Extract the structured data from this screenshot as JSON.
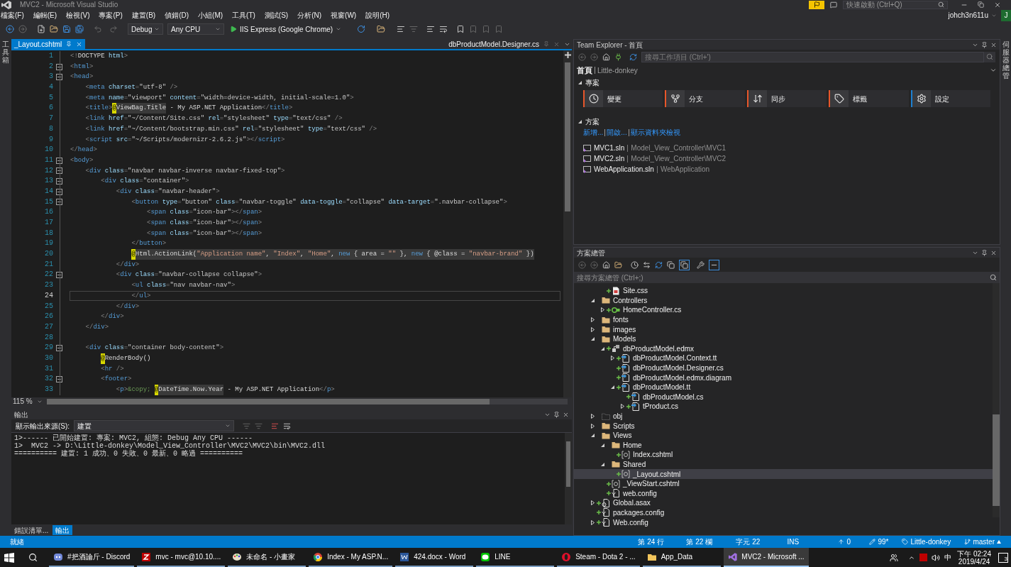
{
  "title_bar": {
    "title": "MVC2 - Microsoft Visual Studio",
    "quick_launch": {
      "placeholder": "快速啟動 (Ctrl+Q)"
    }
  },
  "menu": [
    "檔案(F)",
    "編輯(E)",
    "檢視(V)",
    "專案(P)",
    "建置(B)",
    "偵錯(D)",
    "小組(M)",
    "工具(T)",
    "測試(S)",
    "分析(N)",
    "視窗(W)",
    "說明(H)"
  ],
  "account": {
    "user": "johch3n611u",
    "avatar": "J"
  },
  "toolbar": {
    "configuration": "Debug",
    "platform": "Any CPU",
    "run_target": "IIS Express (Google Chrome)"
  },
  "left_strip": {
    "label": "工具箱"
  },
  "right_strip": {
    "label": "伺服器總管"
  },
  "editor": {
    "tabs": [
      {
        "label": "_Layout.cshtml",
        "selected": true
      },
      {
        "label": "dbProductModel.Designer.cs",
        "selected": false
      }
    ],
    "zoom": "115 %",
    "lines": [
      {
        "n": "1",
        "fold": false,
        "current": false,
        "code": "<!DOCTYPE html>"
      },
      {
        "n": "2",
        "fold": true,
        "current": false,
        "code": "<html>"
      },
      {
        "n": "3",
        "fold": true,
        "current": false,
        "code": "<head>"
      },
      {
        "n": "4",
        "fold": false,
        "current": false,
        "code": "    <meta charset=\"utf-8\" />"
      },
      {
        "n": "5",
        "fold": false,
        "current": false,
        "code": "    <meta name=\"viewport\" content=\"width=device-width, initial-scale=1.0\">"
      },
      {
        "n": "6",
        "fold": false,
        "current": false,
        "code": "    <title>@ViewBag.Title - My ASP.NET Application</title>"
      },
      {
        "n": "7",
        "fold": false,
        "current": false,
        "code": "    <link href=\"~/Content/Site.css\" rel=\"stylesheet\" type=\"text/css\" />"
      },
      {
        "n": "8",
        "fold": false,
        "current": false,
        "code": "    <link href=\"~/Content/bootstrap.min.css\" rel=\"stylesheet\" type=\"text/css\" />"
      },
      {
        "n": "9",
        "fold": false,
        "current": false,
        "code": "    <script src=\"~/Scripts/modernizr-2.6.2.js\"></script>"
      },
      {
        "n": "10",
        "fold": false,
        "current": false,
        "code": "</head>"
      },
      {
        "n": "11",
        "fold": true,
        "current": false,
        "code": "<body>"
      },
      {
        "n": "12",
        "fold": true,
        "current": false,
        "code": "    <div class=\"navbar navbar-inverse navbar-fixed-top\">"
      },
      {
        "n": "13",
        "fold": true,
        "current": false,
        "code": "        <div class=\"container\">"
      },
      {
        "n": "14",
        "fold": true,
        "current": false,
        "code": "            <div class=\"navbar-header\">"
      },
      {
        "n": "15",
        "fold": true,
        "current": false,
        "code": "                <button type=\"button\" class=\"navbar-toggle\" data-toggle=\"collapse\" data-target=\".navbar-collapse\">"
      },
      {
        "n": "16",
        "fold": false,
        "current": false,
        "code": "                    <span class=\"icon-bar\"></span>"
      },
      {
        "n": "17",
        "fold": false,
        "current": false,
        "code": "                    <span class=\"icon-bar\"></span>"
      },
      {
        "n": "18",
        "fold": false,
        "current": false,
        "code": "                    <span class=\"icon-bar\"></span>"
      },
      {
        "n": "19",
        "fold": false,
        "current": false,
        "code": "                </button>"
      },
      {
        "n": "20",
        "fold": false,
        "current": false,
        "code": "                @Html.ActionLink(\"Application name\", \"Index\", \"Home\", new { area = \"\" }, new { @class = \"navbar-brand\" })"
      },
      {
        "n": "21",
        "fold": false,
        "current": false,
        "code": "            </div>"
      },
      {
        "n": "22",
        "fold": true,
        "current": false,
        "code": "            <div class=\"navbar-collapse collapse\">"
      },
      {
        "n": "23",
        "fold": false,
        "current": false,
        "code": "                <ul class=\"nav navbar-nav\">"
      },
      {
        "n": "24",
        "fold": false,
        "current": true,
        "code": "                </ul>"
      },
      {
        "n": "25",
        "fold": false,
        "current": false,
        "code": "            </div>"
      },
      {
        "n": "26",
        "fold": false,
        "current": false,
        "code": "        </div>"
      },
      {
        "n": "27",
        "fold": false,
        "current": false,
        "code": "    </div>"
      },
      {
        "n": "28",
        "fold": false,
        "current": false
      },
      {
        "n": "29",
        "fold": true,
        "current": false,
        "code": "    <div class=\"container body-content\">"
      },
      {
        "n": "30",
        "fold": false,
        "current": false,
        "code": "        @RenderBody()"
      },
      {
        "n": "31",
        "fold": false,
        "current": false,
        "code": "        <hr />"
      },
      {
        "n": "32",
        "fold": true,
        "current": false,
        "code": "        <footer>"
      },
      {
        "n": "33",
        "fold": false,
        "current": false,
        "code": "            <p>&copy; @DateTime.Now.Year - My ASP.NET Application</p>"
      }
    ]
  },
  "output": {
    "title": "輸出",
    "source_label": "顯示輸出來源(S):",
    "source": "建置",
    "lines": [
      "1>------ 已開始建置: 專案: MVC2, 組態: Debug Any CPU ------",
      "1>  MVC2 -> D:\\Little-donkey\\Model_View_Controller\\MVC2\\MVC2\\bin\\MVC2.dll",
      "========== 建置: 1 成功、0 失敗、0 最新、0 略過 =========="
    ]
  },
  "bottom_tabs": [
    {
      "label": "錯誤清單...",
      "selected": false
    },
    {
      "label": "輸出",
      "selected": true
    }
  ],
  "team_explorer": {
    "title": "Team Explorer - 首頁",
    "search": {
      "placeholder": "搜尋工作項目 (Ctrl+')"
    },
    "page": "首頁",
    "repo": "Little-donkey",
    "project_section": {
      "title": "專案",
      "expanded": true,
      "tiles": [
        {
          "kind": "changes",
          "label": "變更",
          "color": "#e8562a"
        },
        {
          "kind": "branches",
          "label": "分支",
          "color": "#e8562a"
        },
        {
          "kind": "sync",
          "label": "同步",
          "color": "#e8562a"
        },
        {
          "kind": "tags",
          "label": "標籤",
          "color": "#e8562a"
        },
        {
          "kind": "settings",
          "label": "設定",
          "color": "#1c7fd1"
        }
      ]
    },
    "solutions_section": {
      "title": "方案",
      "expanded": true,
      "links": [
        "新增...",
        "開啟...",
        "顯示資料夾檢視"
      ],
      "solutions": [
        {
          "name": "MVC1.sln",
          "path": "Model_View_Controller\\MVC1"
        },
        {
          "name": "MVC2.sln",
          "path": "Model_View_Controller\\MVC2"
        },
        {
          "name": "WebApplication.sln",
          "path": "WebApplication"
        }
      ]
    }
  },
  "solution_explorer": {
    "title": "方案總管",
    "search": {
      "placeholder": "搜尋方案總管 (Ctrl+;)"
    },
    "tree": [
      {
        "children": [
          {
            "label": "Site.css",
            "kind": "css",
            "pending_add": true,
            "selected": false
          }
        ]
      },
      {
        "label": "Controllers",
        "kind": "folder",
        "pending_add": false,
        "expanded": true,
        "selected": false,
        "children": [
          {
            "label": "HomeController.cs",
            "kind": "csharp",
            "pending_add": true,
            "expanded": false,
            "selected": false
          }
        ]
      },
      {
        "label": "fonts",
        "kind": "folder",
        "pending_add": false,
        "expanded": false,
        "selected": false
      },
      {
        "label": "images",
        "kind": "folder",
        "pending_add": false,
        "expanded": false,
        "selected": false
      },
      {
        "label": "Models",
        "kind": "folder",
        "pending_add": false,
        "expanded": true,
        "selected": false,
        "children": [
          {
            "label": "dbProductModel.edmx",
            "kind": "edmx",
            "pending_add": true,
            "expanded": true,
            "selected": false,
            "children": [
              {
                "label": "dbProductModel.Context.tt",
                "kind": "template",
                "pending_add": true,
                "expanded": false,
                "selected": false
              },
              {
                "label": "dbProductModel.Designer.cs",
                "kind": "template",
                "pending_add": true,
                "selected": false
              },
              {
                "label": "dbProductModel.edmx.diagram",
                "kind": "template",
                "pending_add": true,
                "selected": false
              },
              {
                "label": "dbProductModel.tt",
                "kind": "template",
                "pending_add": true,
                "expanded": true,
                "selected": false,
                "children": [
                  {
                    "label": "dbProductModel.cs",
                    "kind": "template",
                    "pending_add": true,
                    "selected": false
                  },
                  {
                    "label": "tProduct.cs",
                    "kind": "template",
                    "pending_add": true,
                    "expanded": false,
                    "selected": false
                  }
                ]
              }
            ]
          }
        ]
      },
      {
        "label": "obj",
        "kind": "hidden-folder",
        "pending_add": false,
        "expanded": false,
        "selected": false
      },
      {
        "label": "Scripts",
        "kind": "folder",
        "pending_add": false,
        "expanded": false,
        "selected": false
      },
      {
        "label": "Views",
        "kind": "folder",
        "pending_add": false,
        "expanded": true,
        "selected": false,
        "children": [
          {
            "label": "Home",
            "kind": "folder",
            "pending_add": false,
            "expanded": true,
            "selected": false,
            "children": [
              {
                "label": "Index.cshtml",
                "kind": "razor",
                "pending_add": true,
                "selected": false
              }
            ]
          },
          {
            "label": "Shared",
            "kind": "folder",
            "pending_add": false,
            "expanded": true,
            "selected": false,
            "children": [
              {
                "label": "_Layout.cshtml",
                "kind": "razor",
                "pending_add": true,
                "selected": true
              }
            ]
          },
          {
            "label": "_ViewStart.cshtml",
            "kind": "razor",
            "pending_add": true,
            "selected": false
          },
          {
            "label": "web.config",
            "kind": "config",
            "pending_add": true,
            "selected": false
          }
        ]
      },
      {
        "label": "Global.asax",
        "kind": "asax",
        "pending_add": true,
        "expanded": false,
        "selected": false
      },
      {
        "label": "packages.config",
        "kind": "config",
        "pending_add": true,
        "selected": false
      },
      {
        "label": "Web.config",
        "kind": "config",
        "pending_add": true,
        "expanded": false,
        "selected": false
      }
    ]
  },
  "status_bar": {
    "status": "就緒",
    "line": "第 24 行",
    "column": "第 22 欄",
    "char": "字元 22",
    "mode": "INS",
    "push": "0",
    "changes": "99*",
    "repo": "Little-donkey",
    "branch": "master"
  },
  "taskbar": {
    "items": [
      {
        "kind": "discord",
        "label": "#把酒論斤 - Discord",
        "selected": false
      },
      {
        "kind": "filezilla",
        "label": "mvc - mvc@10.10....",
        "selected": false
      },
      {
        "kind": "paint",
        "label": "未命名 - 小畫家",
        "selected": false
      },
      {
        "kind": "chrome",
        "label": "Index - My ASP.N...",
        "selected": false
      },
      {
        "kind": "word",
        "label": "424.docx - Word",
        "selected": false
      },
      {
        "kind": "line",
        "label": "LINE",
        "selected": false
      },
      {
        "kind": "opera",
        "label": "Steam - Dota 2 - ...",
        "selected": false
      },
      {
        "kind": "folder",
        "label": "App_Data",
        "selected": false
      },
      {
        "kind": "vs",
        "label": "MVC2 - Microsoft ...",
        "selected": true
      }
    ],
    "ime": "中",
    "time": "下午 02:24",
    "date": "2019/4/24",
    "notifications": "3"
  }
}
